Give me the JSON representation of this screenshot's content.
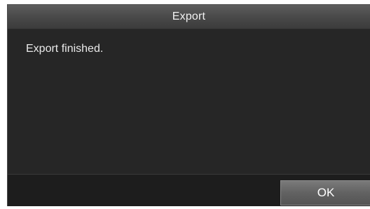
{
  "dialog": {
    "title": "Export",
    "message": "Export finished.",
    "ok_label": "OK"
  }
}
